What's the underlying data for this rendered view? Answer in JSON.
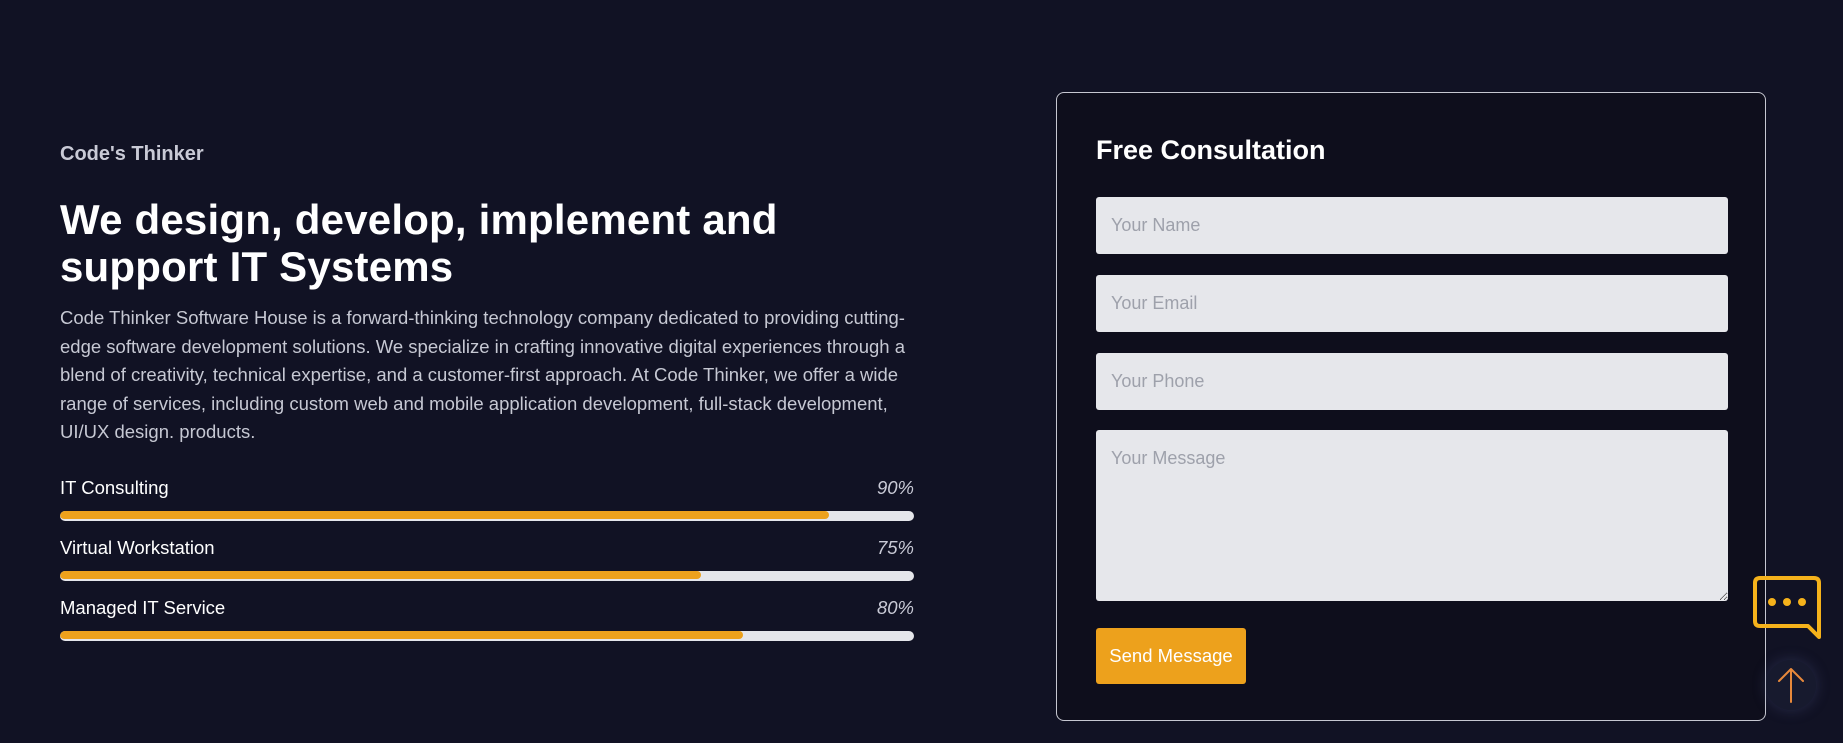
{
  "hero": {
    "eyebrow": "Code's Thinker",
    "headline": "We design, develop, implement and support IT Systems",
    "description": "Code Thinker Software House is a forward-thinking technology company dedicated to providing cutting-edge software development solutions. We specialize in crafting innovative digital experiences through a blend of creativity, technical expertise, and a customer-first approach. At Code Thinker, we offer a wide range of services, including custom web and mobile application development, full-stack development, UI/UX design. products."
  },
  "skills": [
    {
      "name": "IT Consulting",
      "percent_label": "90%",
      "value": 0.9
    },
    {
      "name": "Virtual Workstation",
      "percent_label": "75%",
      "value": 0.75
    },
    {
      "name": "Managed IT Service",
      "percent_label": "80%",
      "value": 0.8
    }
  ],
  "consultation_form": {
    "title": "Free Consultation",
    "name_placeholder": "Your Name",
    "email_placeholder": "Your Email",
    "phone_placeholder": "Your Phone",
    "message_placeholder": "Your Message",
    "submit_label": "Send Message"
  },
  "widgets": {
    "chat_icon": "chat-bubble-icon",
    "scroll_top_icon": "arrow-up-icon"
  },
  "colors": {
    "background": "#111224",
    "card_background": "#0e0e1c",
    "accent": "#eda11c",
    "track": "#e5e6eb",
    "input_background": "#e6e7eb",
    "text_primary": "#ffffff",
    "text_muted": "#c6c8d3",
    "chat_icon": "#f5b21b",
    "scroll_arrow": "#e8893b"
  }
}
